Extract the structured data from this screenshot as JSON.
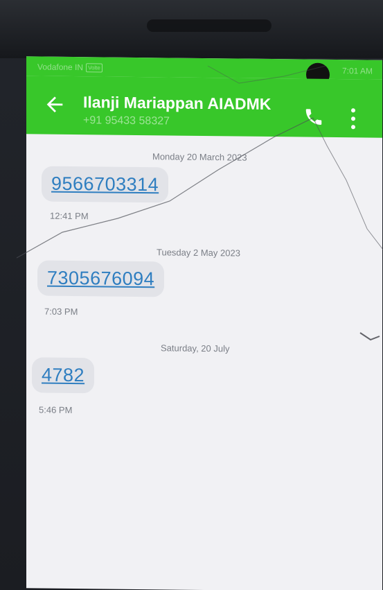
{
  "status_bar": {
    "carrier": "Vodafone IN",
    "volte_badge": "Volte",
    "time": "7:01 AM"
  },
  "header": {
    "contact_name": "Ilanji Mariappan AIADMK",
    "contact_number": "+91 95433 58327",
    "back_icon": "arrow-left-icon",
    "call_icon": "phone-icon",
    "more_icon": "more-vertical-icon"
  },
  "colors": {
    "toolbar": "#38c72a",
    "link": "#2f7ec0",
    "bubble": "#e2e3e8",
    "background": "#f1f1f4"
  },
  "conversation": [
    {
      "date": "Monday 20 March 2023",
      "message": "9566703314",
      "time": "12:41 PM"
    },
    {
      "date": "Tuesday 2 May 2023",
      "message": "7305676094",
      "time": "7:03 PM"
    },
    {
      "date": "Saturday, 20 July",
      "message": "4782",
      "time": "5:46 PM"
    }
  ]
}
